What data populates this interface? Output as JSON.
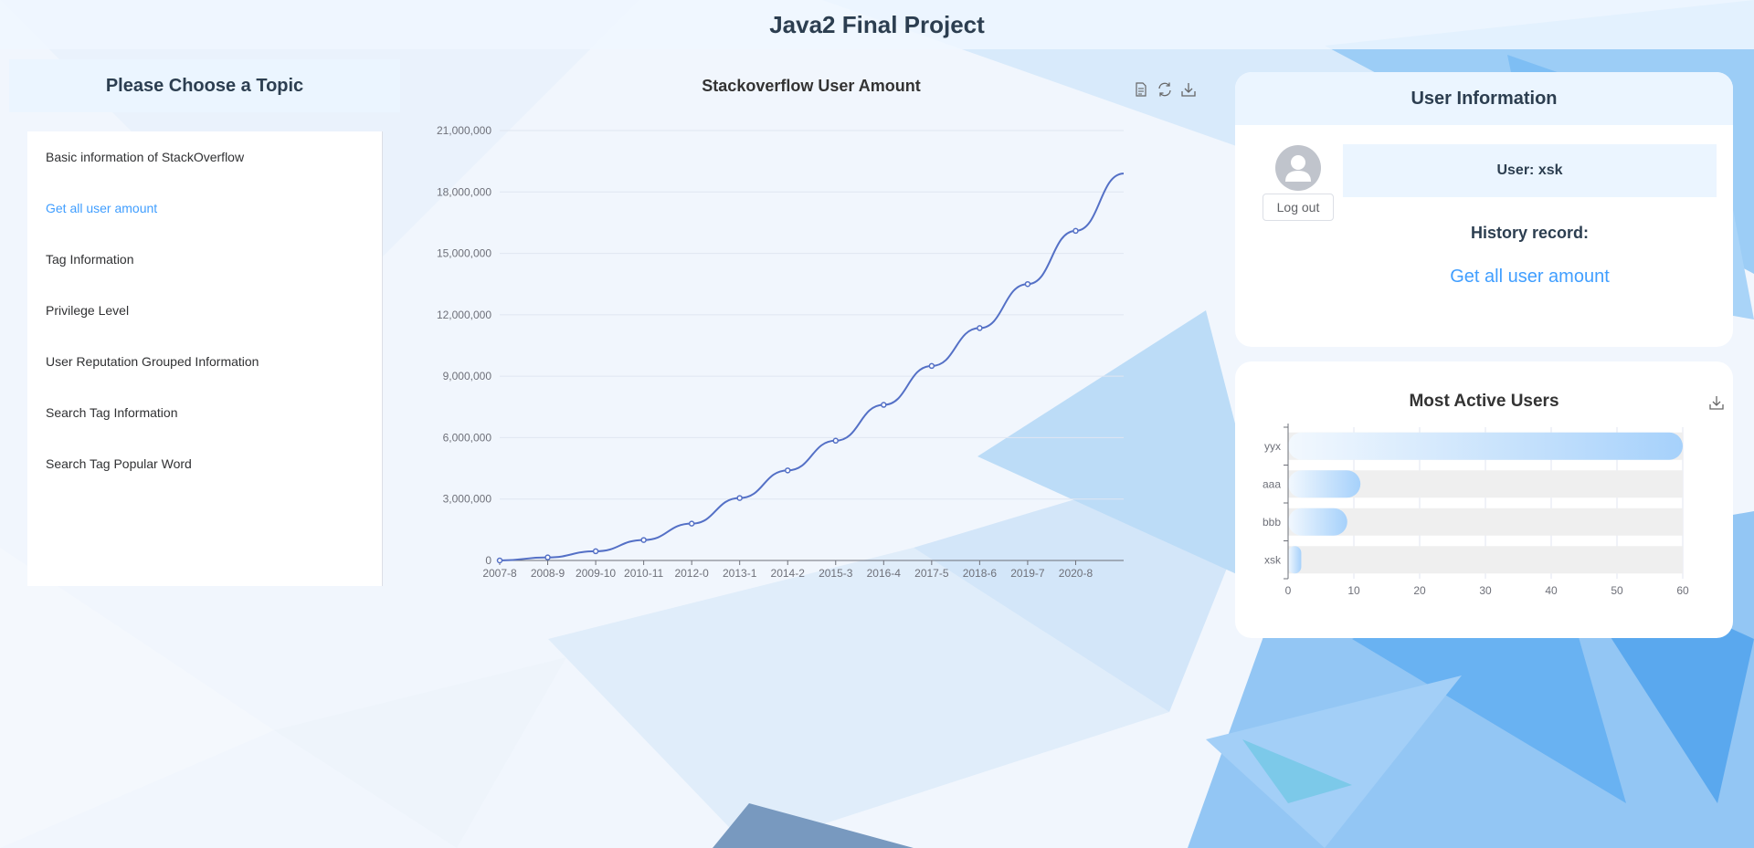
{
  "header": {
    "title": "Java2 Final Project"
  },
  "sidebar": {
    "title": "Please Choose a Topic",
    "items": [
      {
        "label": "Basic information of StackOverflow",
        "active": false
      },
      {
        "label": "Get all user amount",
        "active": true
      },
      {
        "label": "Tag Information",
        "active": false
      },
      {
        "label": "Privilege Level",
        "active": false
      },
      {
        "label": "User Reputation Grouped Information",
        "active": false
      },
      {
        "label": "Search Tag Information",
        "active": false
      },
      {
        "label": "Search Tag Popular Word",
        "active": false
      }
    ]
  },
  "toolbox": {
    "icons": [
      "data-view-icon",
      "refresh-icon",
      "download-icon"
    ]
  },
  "user_panel": {
    "title": "User Information",
    "user_label": "User: xsk",
    "logout_label": "Log out",
    "history_label": "History record:",
    "history_link": "Get all user amount"
  },
  "colors": {
    "accent": "#409eff",
    "line": "#5470c6",
    "bar_track": "#efefef",
    "bar_end": "#a6d1fb"
  },
  "chart_data": [
    {
      "type": "line",
      "title": "Stackoverflow User Amount",
      "xlabel": "",
      "ylabel": "",
      "x_ticks": [
        "2007-8",
        "2008-9",
        "2009-10",
        "2010-11",
        "2012-0",
        "2013-1",
        "2014-2",
        "2015-3",
        "2016-4",
        "2017-5",
        "2018-6",
        "2019-7",
        "2020-8"
      ],
      "y_ticks": [
        "0",
        "3,000,000",
        "6,000,000",
        "9,000,000",
        "12,000,000",
        "15,000,000",
        "18,000,000",
        "21,000,000"
      ],
      "ylim": [
        0,
        21000000
      ],
      "series": [
        {
          "values": [
            0,
            150000,
            450000,
            1000000,
            1800000,
            3050000,
            4400000,
            5850000,
            7600000,
            9500000,
            11350000,
            13500000,
            16100000,
            18900000
          ]
        }
      ],
      "grid": true,
      "legend": "none"
    },
    {
      "type": "bar",
      "orientation": "horizontal",
      "title": "Most Active Users",
      "categories": [
        "xsk",
        "bbb",
        "aaa",
        "yyx"
      ],
      "values": [
        2,
        9,
        11,
        60
      ],
      "x_ticks": [
        "0",
        "10",
        "20",
        "30",
        "40",
        "50",
        "60"
      ],
      "xlim": [
        0,
        60
      ],
      "grid": true,
      "legend": "none"
    }
  ]
}
